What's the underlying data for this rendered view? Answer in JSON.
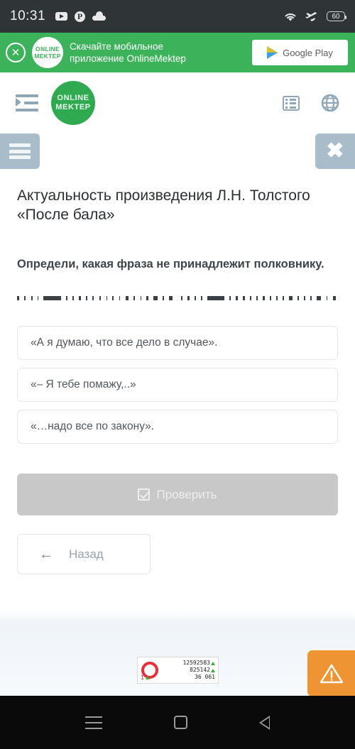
{
  "statusbar": {
    "time": "10:31",
    "icons_left": [
      "youtube-icon",
      "pinterest-icon",
      "cloud-icon"
    ],
    "icons_right": [
      "wifi-icon",
      "airplane-mode-icon",
      "battery-icon"
    ],
    "battery_level": "60"
  },
  "promo": {
    "close_label": "✕",
    "logo_line1": "ONLINE",
    "logo_line2": "MEKTEP",
    "text_line1": "Скачайте мобильное",
    "text_line2": "приложение OnlineMektep",
    "store_button": "Google Play",
    "background_color": "#3cb35b"
  },
  "header": {
    "menu_icon": "indent-list-icon",
    "logo_line1": "ONLINE",
    "logo_line2": "MEKTEP",
    "list_icon": "list-view-icon",
    "globe_icon": "globe-language-icon",
    "logo_color": "#2faa50"
  },
  "chips": {
    "left_icon": "hamburger-menu-icon",
    "right_icon": "close-x-icon",
    "right_label": "✖",
    "color": "#a8bdc9"
  },
  "lesson": {
    "title": "Актуальность произведения Л.Н. Толстого «После бала»",
    "question": "Определи, какая фраза не принадлежит полковнику.",
    "redacted_note": "clipped-text-line",
    "options": [
      {
        "label": "«А я думаю, что все дело в случае»."
      },
      {
        "label": "«– Я тебе помажу,..»"
      },
      {
        "label": "«…надо все по закону»."
      }
    ],
    "check_button": "Проверить",
    "back_button": "Назад",
    "back_arrow": "←"
  },
  "counter": {
    "row1": "12592583",
    "row2": "825142",
    "row3": "36 061",
    "bottom_left": "1",
    "ring_color": "#e8313a",
    "arrow_color": "#2eb82e"
  },
  "warning": {
    "icon": "warning-triangle-icon",
    "color": "#ef9432"
  },
  "navbar": {
    "recent_icon": "recent-apps-icon",
    "home_icon": "home-square-icon",
    "back_icon": "back-triangle-icon"
  }
}
